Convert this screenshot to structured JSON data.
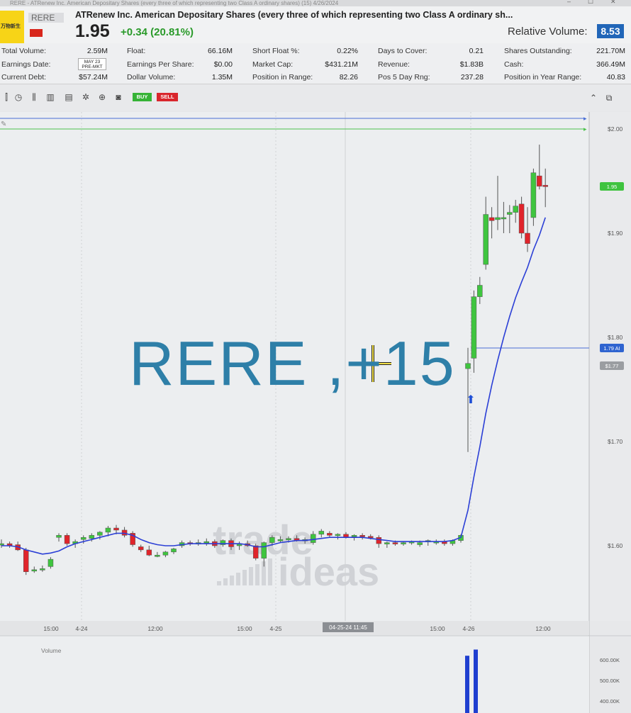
{
  "window": {
    "title": "RERE - ATRenew Inc. American Depositary Shares (every three of which representing two Class A ordinary shares) (15) 4/26/2024"
  },
  "header": {
    "logo_text": "万物新生",
    "ticker": "RERE",
    "company_name": "ATRenew Inc. American Depositary Shares (every three of which representing two Class A ordinary sh...",
    "price": "1.95",
    "change": "+0.34 (20.81%)",
    "relative_volume_label": "Relative Volume:",
    "relative_volume_value": "8.53",
    "change_color": "#2a9a2a",
    "accent_color": "#2166b8"
  },
  "stats": {
    "total_volume_label": "Total Volume:",
    "total_volume": "2.59M",
    "earnings_date_label": "Earnings Date:",
    "earnings_date_l1": "MAY 23",
    "earnings_date_l2": "PRE-MKT",
    "current_debt_label": "Current Debt:",
    "current_debt": "$57.24M",
    "float_label": "Float:",
    "float": "66.16M",
    "eps_label": "Earnings Per Share:",
    "eps": "$0.00",
    "dollar_volume_label": "Dollar Volume:",
    "dollar_volume": "1.35M",
    "short_float_label": "Short Float %:",
    "short_float": "0.22%",
    "market_cap_label": "Market Cap:",
    "market_cap": "$431.21M",
    "position_range_label": "Position in Range:",
    "position_range": "82.26",
    "days_cover_label": "Days to Cover:",
    "days_cover": "0.21",
    "revenue_label": "Revenue:",
    "revenue": "$1.83B",
    "pos5_label": "Pos 5 Day Rng:",
    "pos5": "237.28",
    "shares_out_label": "Shares Outstanding:",
    "shares_out": "221.70M",
    "cash_label": "Cash:",
    "cash": "366.49M",
    "pos_year_label": "Position in Year Range:",
    "pos_year": "40.83"
  },
  "toolbar": {
    "buy_label": "BUY",
    "sell_label": "SELL",
    "icons": [
      "candlestick-icon",
      "clock-icon",
      "ohlc-icon",
      "bar-chart-icon",
      "calculator-icon",
      "bug-icon",
      "add-icon",
      "camera-icon"
    ]
  },
  "chart_data": {
    "type": "candlestick",
    "y_ticks": [
      "$2.00",
      "$1.90",
      "$1.80",
      "$1.70",
      "$1.60"
    ],
    "ylim": [
      1.545,
      2.01
    ],
    "x_tick_labels": [
      "15:00",
      "4-24",
      "12:00",
      "15:00",
      "4-25",
      "04-25-24 11:45",
      "15:00",
      "4-26",
      "12:00"
    ],
    "price_tag_current": "1.95",
    "price_tag_ma": "1.79 AI",
    "price_tag_prev": "$1.77",
    "volume_label": "Volume",
    "volume_ticks": [
      "600.00K",
      "500.00K",
      "400.00K"
    ],
    "overlay_text": "RERE ,+15",
    "watermark_top": "trade",
    "watermark_bottom": "ideas",
    "candles": [
      [
        1.601,
        1.606,
        1.598,
        1.602
      ],
      [
        1.602,
        1.604,
        1.598,
        1.6
      ],
      [
        1.601,
        1.604,
        1.595,
        1.596
      ],
      [
        1.596,
        1.598,
        1.572,
        1.575
      ],
      [
        1.576,
        1.58,
        1.574,
        1.577
      ],
      [
        1.577,
        1.581,
        1.575,
        1.578
      ],
      [
        1.58,
        1.589,
        1.578,
        1.587
      ],
      [
        1.608,
        1.612,
        1.604,
        1.61
      ],
      [
        1.61,
        1.612,
        1.6,
        1.602
      ],
      [
        1.602,
        1.606,
        1.598,
        1.604
      ],
      [
        1.606,
        1.61,
        1.602,
        1.608
      ],
      [
        1.607,
        1.612,
        1.604,
        1.61
      ],
      [
        1.61,
        1.614,
        1.606,
        1.613
      ],
      [
        1.613,
        1.619,
        1.609,
        1.617
      ],
      [
        1.617,
        1.62,
        1.611,
        1.615
      ],
      [
        1.615,
        1.618,
        1.608,
        1.61
      ],
      [
        1.612,
        1.614,
        1.599,
        1.601
      ],
      [
        1.599,
        1.601,
        1.594,
        1.596
      ],
      [
        1.596,
        1.6,
        1.59,
        1.591
      ],
      [
        1.591,
        1.594,
        1.589,
        1.591
      ],
      [
        1.591,
        1.595,
        1.589,
        1.594
      ],
      [
        1.594,
        1.598,
        1.592,
        1.597
      ],
      [
        1.6,
        1.605,
        1.598,
        1.603
      ],
      [
        1.603,
        1.605,
        1.6,
        1.602
      ],
      [
        1.602,
        1.606,
        1.6,
        1.603
      ],
      [
        1.603,
        1.607,
        1.6,
        1.604
      ],
      [
        1.604,
        1.606,
        1.598,
        1.6
      ],
      [
        1.601,
        1.606,
        1.599,
        1.605
      ],
      [
        1.605,
        1.607,
        1.596,
        1.599
      ],
      [
        1.6,
        1.604,
        1.596,
        1.602
      ],
      [
        1.602,
        1.605,
        1.599,
        1.6
      ],
      [
        1.6,
        1.602,
        1.586,
        1.588
      ],
      [
        1.588,
        1.604,
        1.58,
        1.603
      ],
      [
        1.603,
        1.61,
        1.6,
        1.608
      ],
      [
        1.606,
        1.609,
        1.603,
        1.606
      ],
      [
        1.606,
        1.609,
        1.603,
        1.607
      ],
      [
        1.607,
        1.61,
        1.604,
        1.605
      ],
      [
        1.605,
        1.608,
        1.602,
        1.606
      ],
      [
        1.603,
        1.614,
        1.601,
        1.611
      ],
      [
        1.611,
        1.616,
        1.608,
        1.614
      ],
      [
        1.612,
        1.614,
        1.608,
        1.61
      ],
      [
        1.61,
        1.612,
        1.606,
        1.611
      ],
      [
        1.611,
        1.613,
        1.607,
        1.608
      ],
      [
        1.609,
        1.611,
        1.605,
        1.61
      ],
      [
        1.61,
        1.612,
        1.606,
        1.609
      ],
      [
        1.609,
        1.611,
        1.606,
        1.608
      ],
      [
        1.608,
        1.61,
        1.598,
        1.602
      ],
      [
        1.602,
        1.604,
        1.598,
        1.603
      ],
      [
        1.603,
        1.605,
        1.6,
        1.602
      ],
      [
        1.602,
        1.604,
        1.6,
        1.603
      ],
      [
        1.603,
        1.605,
        1.601,
        1.604
      ],
      [
        1.601,
        1.605,
        1.599,
        1.603
      ],
      [
        1.604,
        1.606,
        1.6,
        1.605
      ],
      [
        1.603,
        1.606,
        1.601,
        1.604
      ],
      [
        1.604,
        1.606,
        1.6,
        1.602
      ],
      [
        1.602,
        1.606,
        1.6,
        1.605
      ],
      [
        1.605,
        1.611,
        1.603,
        1.61
      ],
      [
        1.77,
        1.79,
        1.69,
        1.775
      ],
      [
        1.78,
        1.845,
        1.766,
        1.839
      ],
      [
        1.839,
        1.858,
        1.832,
        1.85
      ],
      [
        1.87,
        1.935,
        1.865,
        1.918
      ],
      [
        1.915,
        1.925,
        1.895,
        1.912
      ],
      [
        1.913,
        1.955,
        1.903,
        1.915
      ],
      [
        1.914,
        1.93,
        1.9,
        1.915
      ],
      [
        1.918,
        1.927,
        1.9,
        1.92
      ],
      [
        1.92,
        1.932,
        1.91,
        1.926
      ],
      [
        1.928,
        1.935,
        1.895,
        1.9
      ],
      [
        1.9,
        1.925,
        1.882,
        1.89
      ],
      [
        1.915,
        1.962,
        1.907,
        1.958
      ],
      [
        1.955,
        1.985,
        1.942,
        1.945
      ],
      [
        1.946,
        1.962,
        1.925,
        1.945
      ]
    ],
    "ma": [
      1.6,
      1.6,
      1.599,
      1.596,
      1.594,
      1.592,
      1.593,
      1.595,
      1.599,
      1.602,
      1.604,
      1.606,
      1.608,
      1.61,
      1.612,
      1.612,
      1.61,
      1.606,
      1.603,
      1.601,
      1.6,
      1.6,
      1.601,
      1.602,
      1.602,
      1.602,
      1.602,
      1.602,
      1.602,
      1.602,
      1.601,
      1.599,
      1.599,
      1.601,
      1.603,
      1.604,
      1.605,
      1.605,
      1.606,
      1.607,
      1.608,
      1.608,
      1.608,
      1.608,
      1.608,
      1.607,
      1.606,
      1.605,
      1.604,
      1.604,
      1.604,
      1.604,
      1.604,
      1.604,
      1.604,
      1.605,
      1.608,
      1.634,
      1.666,
      1.695,
      1.727,
      1.754,
      1.778,
      1.8,
      1.82,
      1.838,
      1.853,
      1.867,
      1.884,
      1.898,
      1.915
    ],
    "volume": [
      {
        "x": 659,
        "v": 620000
      },
      {
        "x": 671,
        "v": 650000
      }
    ]
  }
}
